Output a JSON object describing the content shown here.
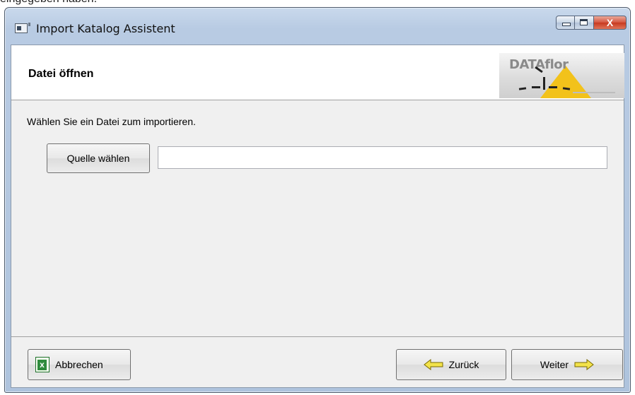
{
  "background": {
    "caption": "eingegeben haben."
  },
  "window": {
    "title": "Import Katalog Assistent",
    "close_glyph": "X"
  },
  "header": {
    "title": "Datei öffnen",
    "logo": {
      "text_data": "DATA",
      "text_flor": "flor"
    }
  },
  "main": {
    "instruction": "Wählen Sie ein Datei zum importieren.",
    "choose_source_label": "Quelle wählen",
    "source_path_value": ""
  },
  "footer": {
    "cancel_label": "Abbrechen",
    "back_label": "Zurück",
    "next_label": "Weiter"
  },
  "colors": {
    "client_bg": "#f0f0f0",
    "arrow_yellow": "#f3e34a",
    "logo_triangle": "#f2c21b",
    "close_red": "#c7391f"
  },
  "icons": {
    "app": "app-window-icon",
    "cancel": "excel-icon",
    "back": "arrow-left-icon",
    "next": "arrow-right-icon"
  }
}
